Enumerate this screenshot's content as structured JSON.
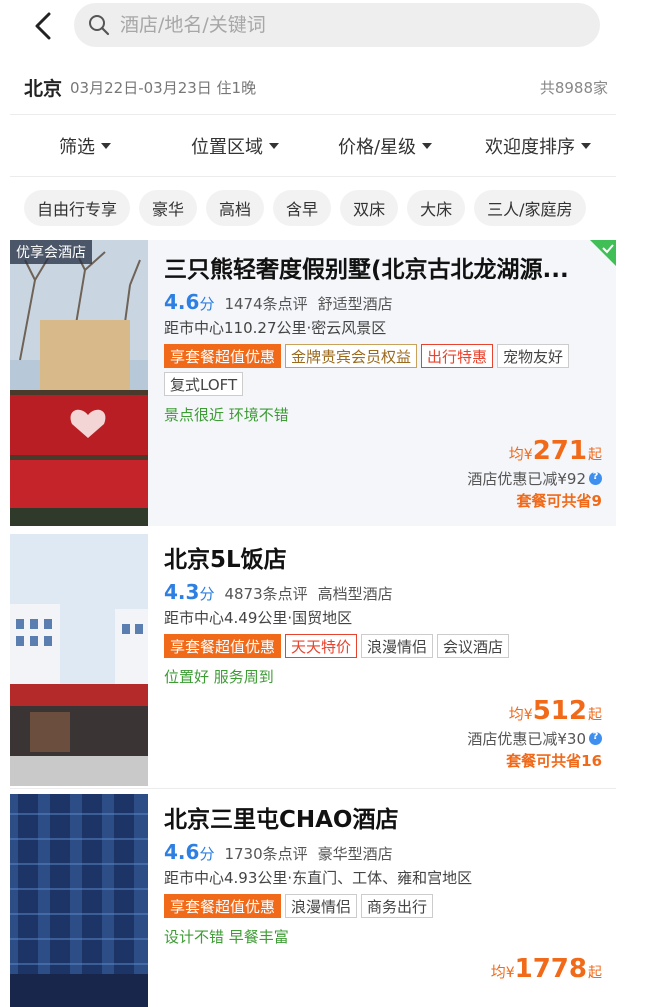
{
  "search": {
    "placeholder": "酒店/地名/关键词"
  },
  "trip": {
    "city": "北京",
    "dates": "03月22日-03月23日 住1晚",
    "count": "共8988家"
  },
  "filters": [
    {
      "label": "筛选"
    },
    {
      "label": "位置区域"
    },
    {
      "label": "价格/星级"
    },
    {
      "label": "欢迎度排序"
    }
  ],
  "quick_tags": [
    "自由行专享",
    "豪华",
    "高档",
    "含早",
    "双床",
    "大床",
    "三人/家庭房"
  ],
  "hotels": [
    {
      "badge": "优享会酒店",
      "name": "三只熊轻奢度假别墅(北京古北龙湖源...",
      "score": "4.6",
      "score_unit": "分",
      "reviews": "1474条点评",
      "level": "舒适型酒店",
      "distance": "距市中心110.27公里·密云风景区",
      "tags": [
        {
          "text": "享套餐超值优惠",
          "style": "package"
        },
        {
          "text": "金牌贵宾会员权益",
          "style": "gold"
        },
        {
          "text": "出行特惠",
          "style": "red"
        },
        {
          "text": "宠物友好",
          "style": "plain"
        },
        {
          "text": "复式LOFT",
          "style": "plain"
        }
      ],
      "highlights": "景点很近 环境不错",
      "avg_label": "均",
      "currency": "¥",
      "price": "271",
      "qi": "起",
      "discount": "酒店优惠已减¥92",
      "savings": "套餐可共省9"
    },
    {
      "name": "北京5L饭店",
      "score": "4.3",
      "score_unit": "分",
      "reviews": "4873条点评",
      "level": "高档型酒店",
      "distance": "距市中心4.49公里·国贸地区",
      "tags": [
        {
          "text": "享套餐超值优惠",
          "style": "package"
        },
        {
          "text": "天天特价",
          "style": "red"
        },
        {
          "text": "浪漫情侣",
          "style": "plain"
        },
        {
          "text": "会议酒店",
          "style": "plain"
        }
      ],
      "highlights": "位置好 服务周到",
      "avg_label": "均",
      "currency": "¥",
      "price": "512",
      "qi": "起",
      "discount": "酒店优惠已减¥30",
      "savings": "套餐可共省16"
    },
    {
      "name": "北京三里屯CHAO酒店",
      "score": "4.6",
      "score_unit": "分",
      "reviews": "1730条点评",
      "level": "豪华型酒店",
      "distance": "距市中心4.93公里·东直门、工体、雍和宫地区",
      "tags": [
        {
          "text": "享套餐超值优惠",
          "style": "package"
        },
        {
          "text": "浪漫情侣",
          "style": "plain"
        },
        {
          "text": "商务出行",
          "style": "plain"
        }
      ],
      "highlights": "设计不错 早餐丰富",
      "avg_label": "均",
      "currency": "¥",
      "price": "1778",
      "qi": "起"
    }
  ],
  "colors": {
    "accent_orange": "#f06a1a",
    "score_blue": "#2d7fe2",
    "highlight_green": "#3e9c35",
    "selected_card_bg": "#f4f6fa"
  },
  "icons": [
    "back-arrow-icon",
    "search-icon",
    "caret-down-icon",
    "check-corner-icon",
    "info-icon"
  ]
}
